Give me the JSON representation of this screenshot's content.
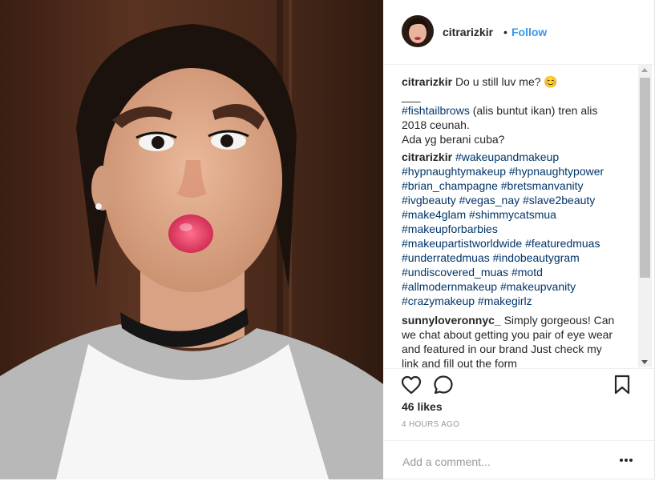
{
  "post": {
    "username": "citrarizkir",
    "separator": "•",
    "follow_label": "Follow"
  },
  "comments": [
    {
      "username": "citrarizkir",
      "lines": [
        "Do u still luv me? 😊",
        "___",
        "#fishtailbrows (alis buntut ikan) tren alis",
        "2018 ceunah.",
        "Ada yg berani cuba?"
      ]
    },
    {
      "username": "citrarizkir",
      "lines": [
        "#wakeupandmakeup",
        "#hypnaughtymakeup #hypnaughtypower",
        "#brian_champagne #bretsmanvanity",
        "#ivgbeauty #vegas_nay #slave2beauty",
        "#make4glam #shimmycatsmua",
        "#makeupforbarbies",
        "#makeupartistworldwide #featuredmuas",
        "#underratedmuas #indobeautygram",
        "#undiscovered_muas #motd",
        "#allmodernmakeup #makeupvanity",
        "#crazymakeup #makegirlz"
      ]
    },
    {
      "username": "sunnyloveronnyc_",
      "lines": [
        "Simply gorgeous! Can",
        "we chat about getting you pair of eye wear",
        "and featured in our brand Just check my",
        "link and fill out the form"
      ]
    }
  ],
  "actions": {
    "like_icon": "heart-icon",
    "comment_icon": "speech-bubble-icon",
    "save_icon": "bookmark-icon",
    "likes_text": "46 likes",
    "timestamp": "4 HOURS AGO"
  },
  "add_comment": {
    "placeholder": "Add a comment...",
    "more_icon": "more-options-icon"
  },
  "colors": {
    "link_blue": "#3897f0",
    "hashtag": "#003569",
    "muted": "#999999",
    "text": "#262626"
  }
}
